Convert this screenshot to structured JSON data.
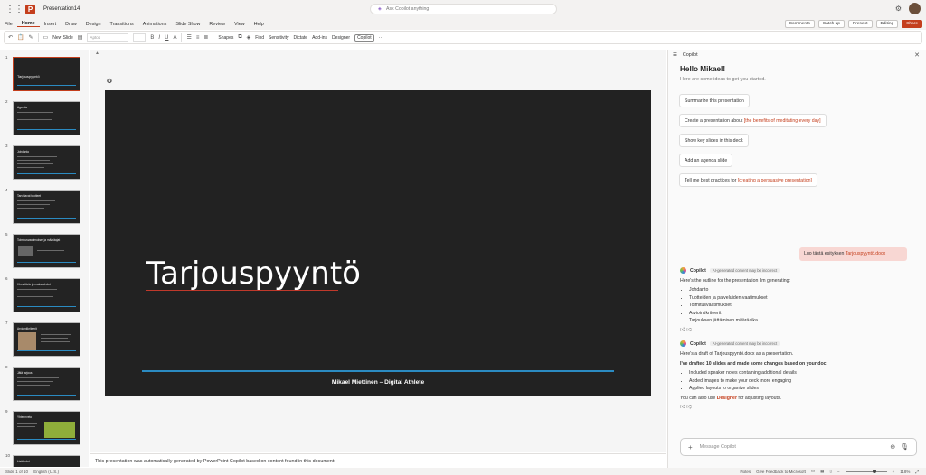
{
  "titlebar": {
    "doc_title": "Presentation14",
    "search_placeholder": "Ask Copilot anything"
  },
  "menu": [
    "File",
    "Home",
    "Insert",
    "Draw",
    "Design",
    "Transitions",
    "Animations",
    "Slide Show",
    "Review",
    "View",
    "Help"
  ],
  "menu_right": {
    "comments": "Comments",
    "catchup": "Catch up",
    "present": "Present",
    "editing": "Editing",
    "share": "Share"
  },
  "ribbon": {
    "new_slide": "New Slide",
    "font": "Aptos",
    "shapes": "Shapes",
    "find": "Find",
    "sensitivity": "Sensitivity",
    "dictate": "Dictate",
    "addins": "Add-ins",
    "designer": "Designer",
    "copilot": "Copilot"
  },
  "thumbnails": [
    {
      "num": "1",
      "title": "Tarjouspyyntö"
    },
    {
      "num": "2",
      "title": "Agenda"
    },
    {
      "num": "3",
      "title": "Johdanto"
    },
    {
      "num": "4",
      "title": "Tarvittavat tuotteet"
    },
    {
      "num": "5",
      "title": "Toimitusvaatimukset ja määräajat"
    },
    {
      "num": "6",
      "title": "Hinnoittelu ja maksuehdot"
    },
    {
      "num": "7",
      "title": "Arviointikriteerit"
    },
    {
      "num": "8",
      "title": "Jätä tarjous"
    },
    {
      "num": "9",
      "title": "Yhteenveto"
    },
    {
      "num": "10",
      "title": "Lisätiedot"
    }
  ],
  "slide": {
    "title": "Tarjouspyyntö",
    "footer": "Mikael Miettinen – Digital Athlete"
  },
  "notes": "This presentation was automatically generated by PowerPoint Copilot based on content found in this document:",
  "status": {
    "slide": "Slide 1 of 10",
    "lang": "English (U.S.)",
    "notes": "Notes",
    "feedback": "Give Feedback to Microsoft",
    "zoom": "118%"
  },
  "copilot": {
    "header": "Copilot",
    "hello": "Hello Mikael!",
    "ideas": "Here are some ideas to get you started.",
    "chips": [
      {
        "text": "Summarize this presentation",
        "accent": ""
      },
      {
        "text": "Create a presentation about ",
        "accent": "[the benefits of meditating every day]"
      },
      {
        "text": "Show key slides in this deck",
        "accent": ""
      },
      {
        "text": "Add an agenda slide",
        "accent": ""
      },
      {
        "text": "Tell me best practices for ",
        "accent": "[creating a persuasive presentation]"
      }
    ],
    "user_msg": "Luo tästä esityksen",
    "user_link": "Tarjouspyyntö.docx",
    "name": "Copilot",
    "disclaimer": "AI-generated content may be incorrect",
    "resp1_intro": "Here's the outline for the presentation I'm generating:",
    "resp1_items": [
      "Johdanto",
      "Tuotteiden ja palveluiden vaatimukset",
      "Toimitusvaatimukset",
      "Arviointikriteerit",
      "Tarjouksen jättämisen määräaika"
    ],
    "resp2_intro": "Here's a draft of Tarjouspyyntö.docx as a presentation.",
    "resp2_bold": "I've drafted 10 slides and made some changes based on your doc:",
    "resp2_items": [
      "Included speaker notes containing additional details",
      "Added images to make your deck more engaging",
      "Applied layouts to organize slides"
    ],
    "resp2_tail_a": "You can also use ",
    "resp2_designer": "Designer",
    "resp2_tail_b": " for adjusting layouts.",
    "composer_placeholder": "Message Copilot"
  }
}
